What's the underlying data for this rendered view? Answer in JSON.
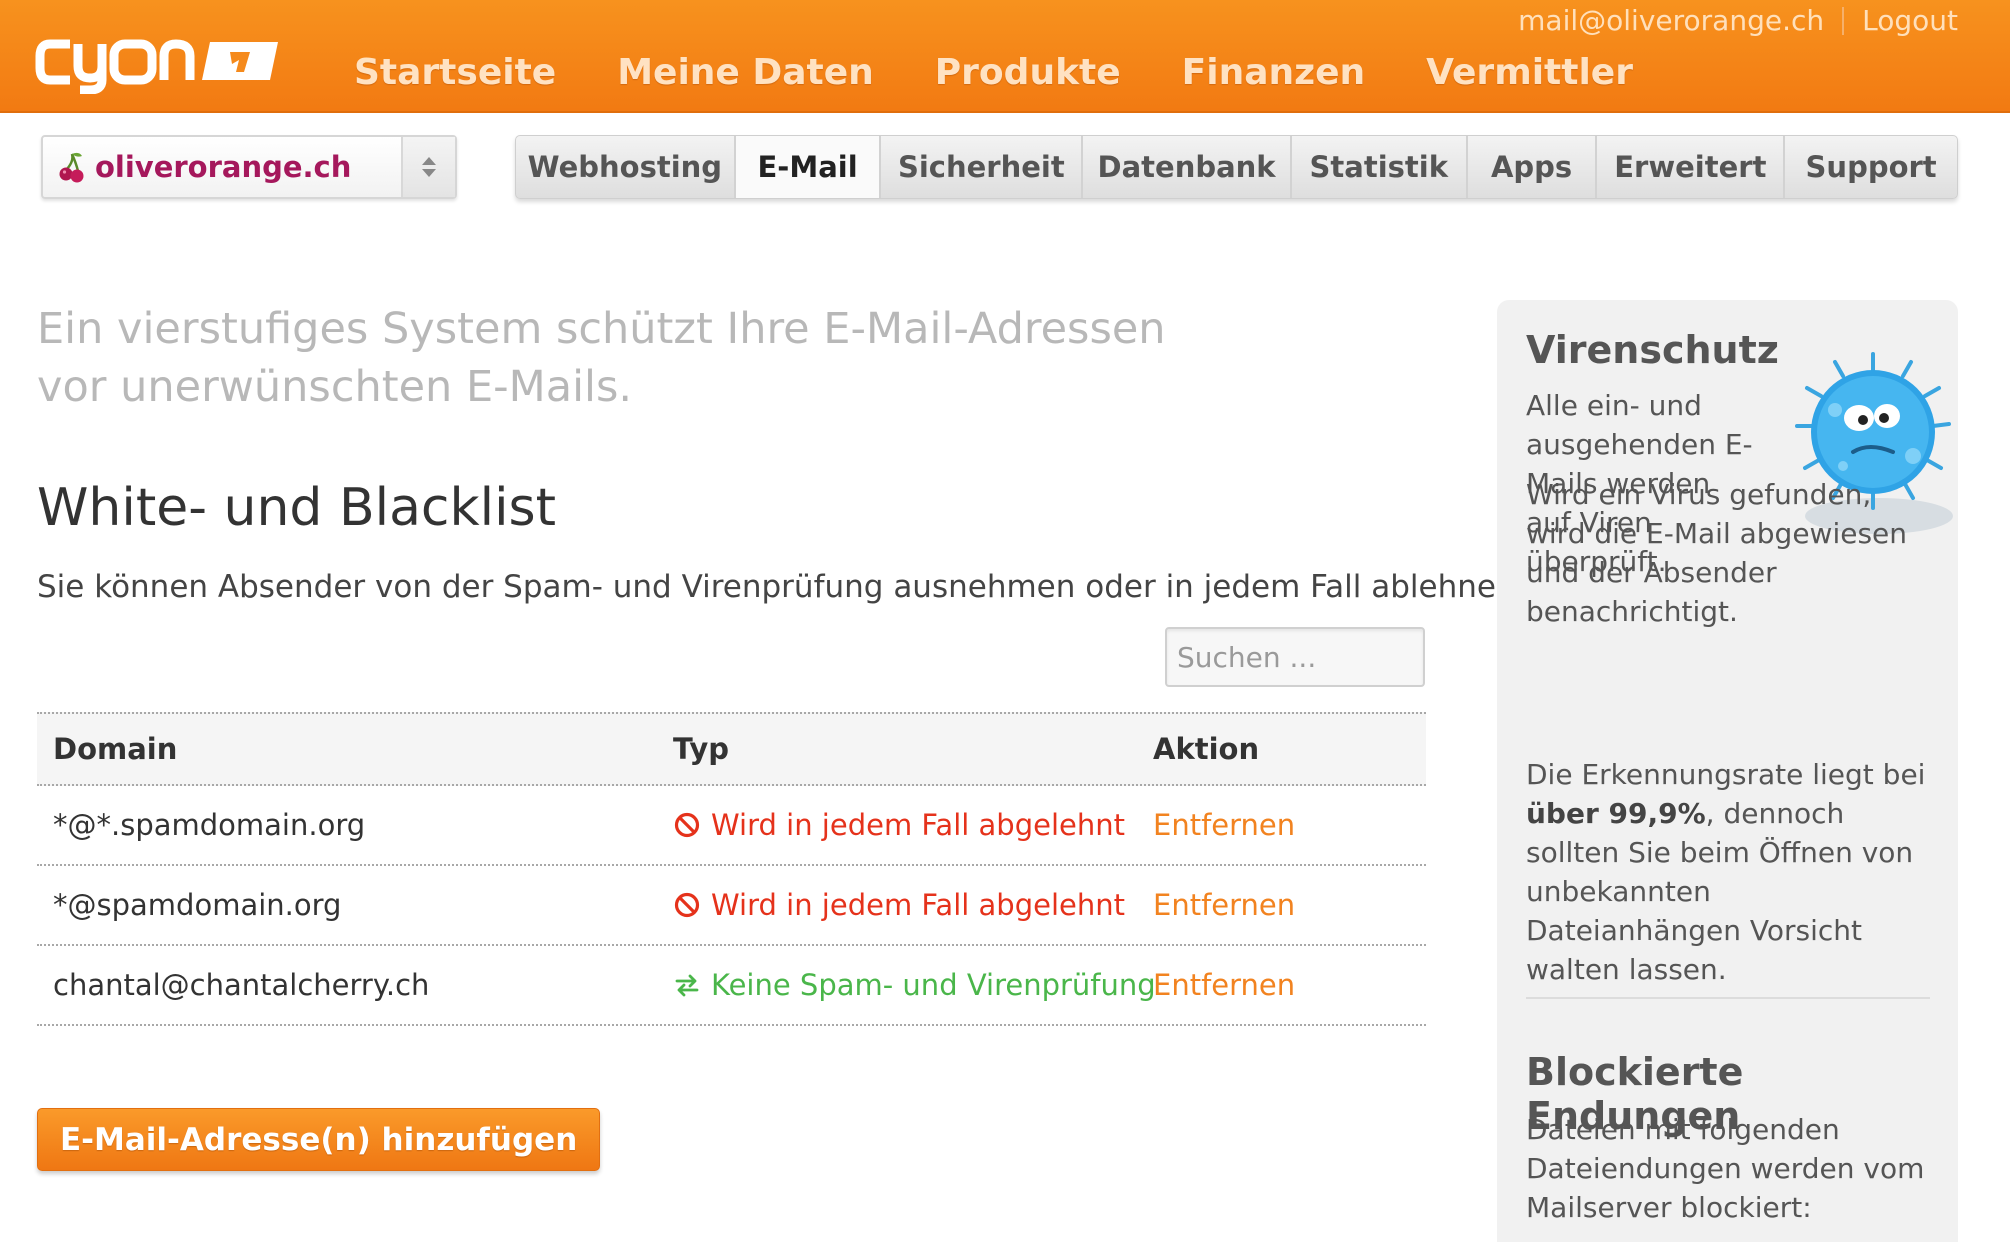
{
  "topbar": {
    "logo_text": "cyon",
    "user_email": "mail@oliverorange.ch",
    "logout_label": "Logout",
    "nav": [
      "Startseite",
      "Meine Daten",
      "Produkte",
      "Finanzen",
      "Vermittler"
    ]
  },
  "domain_select": {
    "value": "oliverorange.ch",
    "icon": "cherry-icon"
  },
  "subnav": {
    "tabs": [
      {
        "label": "Webhosting",
        "active": false
      },
      {
        "label": "E-Mail",
        "active": true
      },
      {
        "label": "Sicherheit",
        "active": false
      },
      {
        "label": "Datenbank",
        "active": false
      },
      {
        "label": "Statistik",
        "active": false
      },
      {
        "label": "Apps",
        "active": false
      },
      {
        "label": "Erweitert",
        "active": false
      },
      {
        "label": "Support",
        "active": false
      }
    ]
  },
  "main": {
    "intro": "Ein vierstufiges System schützt Ihre E-Mail-Adressen vor unerwünschten E-Mails.",
    "section_title": "White- und Blacklist",
    "section_desc": "Sie können Absender von der Spam- und Virenprüfung ausnehmen oder in jedem Fall ablehnen.",
    "search_placeholder": "Suchen ...",
    "table": {
      "headers": {
        "domain": "Domain",
        "type": "Typ",
        "action": "Aktion"
      },
      "rows": [
        {
          "domain": "*@*.spamdomain.org",
          "type": "Wird in jedem Fall abgelehnt",
          "type_icon": "block-icon",
          "action": "Entfernen"
        },
        {
          "domain": "*@spamdomain.org",
          "type": "Wird in jedem Fall abgelehnt",
          "type_icon": "block-icon",
          "action": "Entfernen"
        },
        {
          "domain": "chantal@chantalcherry.ch",
          "type": "Keine Spam- und Virenprüfung",
          "type_icon": "swap-arrows-icon",
          "action": "Entfernen"
        }
      ]
    },
    "add_button": "E-Mail-Adresse(n) hinzufügen"
  },
  "sidebar": {
    "virus_title": "Virenschutz",
    "virus_text1": "Alle ein- und ausgehenden E-Mails werden auf Viren überprüft.",
    "virus_text2": "Wird ein Virus gefunden, wird die E-Mail abgewiesen und der Absender benachrichtigt.",
    "virus_text3_pre": "Die Erkennungsrate liegt bei",
    "virus_text3_bold": "über 99,9%",
    "virus_text3_post": ", dennoch sollten Sie beim Öffnen von unbekannten Dateianhängen Vorsicht walten lassen.",
    "blocked_title": "Blockierte Endungen",
    "blocked_text": "Dateien mit folgenden Dateiendungen werden vom Mailserver blockiert:"
  },
  "colors": {
    "brand_orange": "#f5861a",
    "domain_magenta": "#a5185c",
    "block_red": "#e5321b",
    "allow_green": "#4ab64a",
    "action_orange": "#f28320"
  }
}
